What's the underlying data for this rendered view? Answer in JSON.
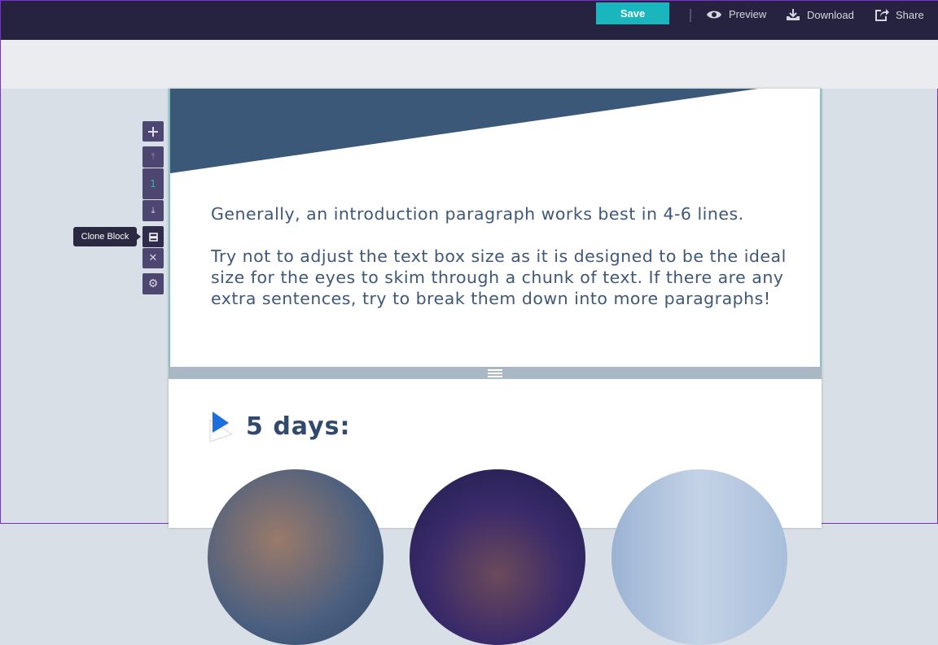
{
  "toolbar": {
    "save_label": "Save",
    "preview_label": "Preview",
    "download_label": "Download",
    "share_label": "Share"
  },
  "block_controls": {
    "block_number": "1",
    "tooltip": "Clone Block"
  },
  "content": {
    "paragraph1": "Generally, an introduction paragraph works best in 4-6 lines.",
    "paragraph2": "Try not to adjust the text box size as it is designed to be the ideal size for the eyes to skim through a chunk of text. If there are any extra sentences, try to break them down into more paragraphs!",
    "heading": "5 days:"
  },
  "colors": {
    "topbar": "#262341",
    "accent": "#19b7bd",
    "banner": "#3b5878",
    "heading": "#2f4a6d"
  }
}
